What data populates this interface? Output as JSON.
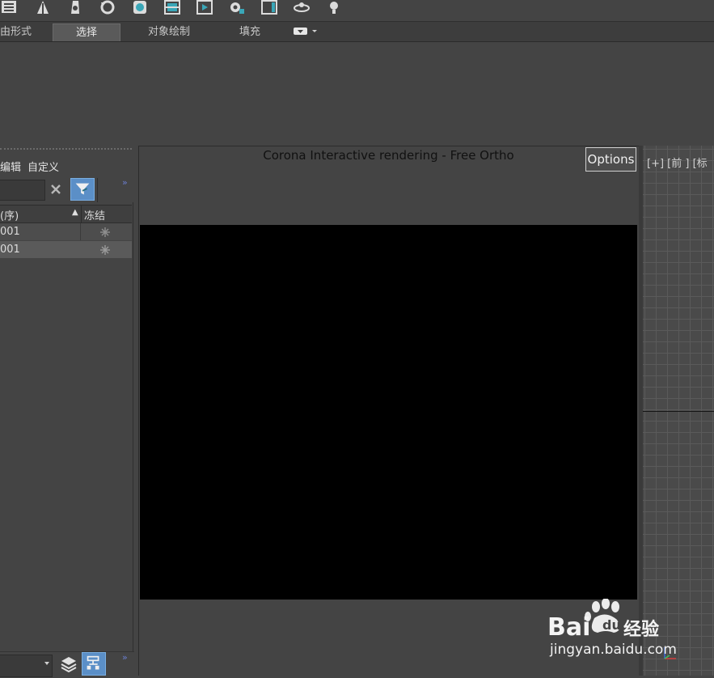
{
  "toolbar": {
    "icons": [
      "layout-icon",
      "hierarchy-icon",
      "motion-icon",
      "display-icon",
      "material-icon",
      "render-setup-icon",
      "render-frame-icon",
      "render-production-icon",
      "viewport-icon",
      "orbit-icon",
      "light-icon"
    ]
  },
  "ribbon": {
    "tabs": [
      "由形式",
      "选择",
      "对象绘制",
      "填充"
    ],
    "active_tab": "选择"
  },
  "explorer": {
    "menu": [
      "编辑",
      "自定义"
    ],
    "search_value": "",
    "columns": [
      "(序)",
      "冻结"
    ],
    "sort_indicator": "▲",
    "rows": [
      {
        "name": "001",
        "frozen_icon": "snowflake-icon"
      },
      {
        "name": "001",
        "frozen_icon": "snowflake-icon"
      }
    ],
    "expand_glyph": "»"
  },
  "corona": {
    "title": "Corona Interactive rendering - Free Ortho",
    "options_label": "Options"
  },
  "viewport": {
    "label": "[+] [前 ] [标"
  },
  "watermark": {
    "brand": "Bai du 经验",
    "url": "jingyan.baidu.com"
  },
  "colors": {
    "accent": "#5b8fc7",
    "panel": "#444444",
    "render_bg": "#000000"
  }
}
